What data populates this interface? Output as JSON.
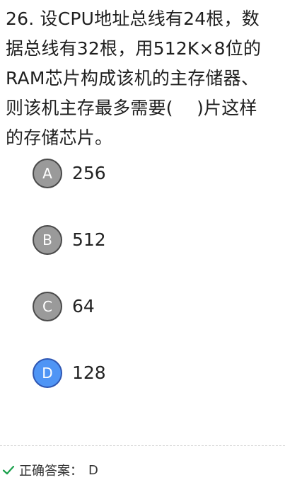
{
  "question": {
    "text": "26. 设CPU地址总线有24根，数据总线有32根，用512K×8位的RAM芯片构成该机的主存储器、则该机主存最多需要(　 )片这样的存储芯片。"
  },
  "options": [
    {
      "letter": "A",
      "text": "256",
      "state": "unselected"
    },
    {
      "letter": "B",
      "text": "512",
      "state": "unselected"
    },
    {
      "letter": "C",
      "text": "64",
      "state": "unselected"
    },
    {
      "letter": "D",
      "text": "128",
      "state": "selected"
    }
  ],
  "answer": {
    "label": "正确答案：",
    "value": "D",
    "icon": "check-icon"
  },
  "colors": {
    "selected": "#4f95f5",
    "unselected": "#9a9a9a",
    "check": "#19a04b"
  }
}
